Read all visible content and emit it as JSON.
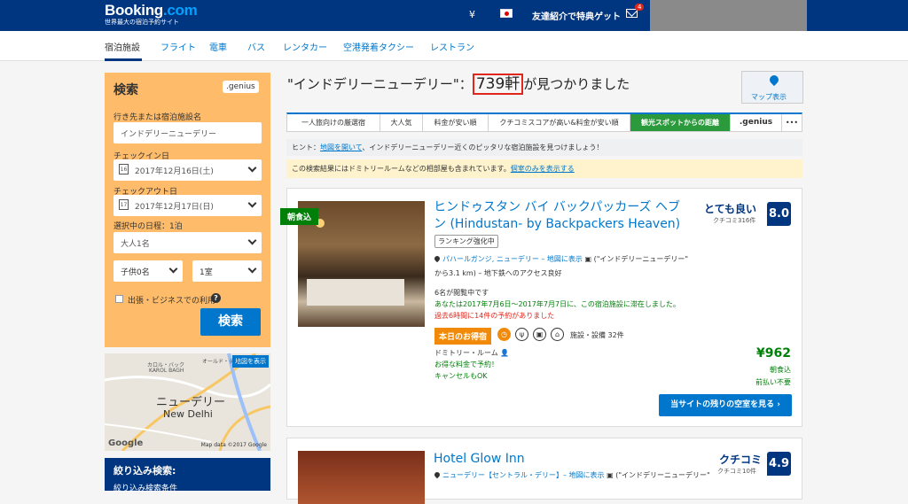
{
  "header": {
    "logo_main": "Booking",
    "logo_suffix": ".com",
    "logo_sub": "世界最大の宿泊予約サイト",
    "currency": "¥",
    "invite": "友達紹介で特典ゲット",
    "mail_badge": "4"
  },
  "nav": {
    "items": [
      "宿泊施設",
      "フライト",
      "電車",
      "バス",
      "レンタカー",
      "空港発着タクシー",
      "レストラン"
    ]
  },
  "search": {
    "title": "検索",
    "genius": ".genius",
    "dest_label": "行き先または宿泊施設名",
    "dest_value": "インドデリーニューデリー",
    "checkin_label": "チェックイン日",
    "checkin_day": "16",
    "checkin_value": "2017年12月16日(土)",
    "checkout_label": "チェックアウト日",
    "checkout_day": "17",
    "checkout_value": "2017年12月17日(日)",
    "nights": "選択中の日程：1泊",
    "adults": "大人1名",
    "children": "子供0名",
    "rooms": "1室",
    "business": "出張・ビジネスでの利用",
    "help": "?",
    "button": "検索"
  },
  "map": {
    "show": "地図を表示",
    "city_ja": "ニューデリー",
    "city_en": "New Delhi",
    "area1": "カロル・バック",
    "area2": "KAROL BAGH",
    "area3": "オールド・デリー",
    "google": "Google",
    "data": "Map data ©2017 Google"
  },
  "filter": {
    "title": "絞り込み検索:",
    "sub": "絞り込み検索条件"
  },
  "results": {
    "prefix": "\"インドデリーニューデリー\"：",
    "count": "739軒",
    "suffix": "が見つかりました",
    "map_button": "マップ表示"
  },
  "sort": {
    "items": [
      "一人旅向けの厳選宿",
      "大人気",
      "料金が安い順",
      "クチコミスコアが高い&料金が安い順",
      "観光スポットからの距離",
      ".genius",
      "•••"
    ]
  },
  "hint": {
    "prefix": "ヒント：",
    "link": "地図を開いて",
    "text": "、インドデリーニューデリー近くのピッタリな宿泊施設を見つけましょう！"
  },
  "notice": {
    "text": "この検索結果にはドミトリールームなどの相部屋も含まれています。",
    "link": "個室のみを表示する"
  },
  "hotel1": {
    "badge": "朝食込",
    "name": "ヒンドゥスタン バイ バックパッカーズ ヘブン (Hindustan- by Backpackers Heaven)",
    "rank": "ランキング強化中",
    "area": "パハールガンジ, ニューデリー – 地図に表示",
    "dist_a": "(\"インドデリーニューデリー\"",
    "dist_b": "から3.1 km) – 地下鉄へのアクセス良好",
    "viewing": "6名が閲覧中です",
    "stayed": "あなたは2017年7月6日～2017年7月7日に、この宿泊施設に滞在しました。",
    "booked": "過去6時間に14件の予約がありました",
    "deal": "本日のお得宿",
    "facilities": "施設・設備 32件",
    "room": "ドミトリー・ルーム",
    "green1": "お得な料金で予約！",
    "green2": "キャンセルもOK",
    "rating_word": "とても良い",
    "rating_count": "クチコミ316件",
    "score": "8.0",
    "price": "¥962",
    "price_note1": "朝食込",
    "price_note2": "前払い不要",
    "button": "当サイトの残りの空室を見る ›"
  },
  "hotel2": {
    "name": "Hotel Glow Inn",
    "area": "ニューデリー【セントラル・デリー】– 地図に表示",
    "dist": "(\"インドデリーニューデリー\"",
    "rating_word": "クチコミ",
    "rating_count": "クチコミ10件",
    "score": "4.9"
  }
}
